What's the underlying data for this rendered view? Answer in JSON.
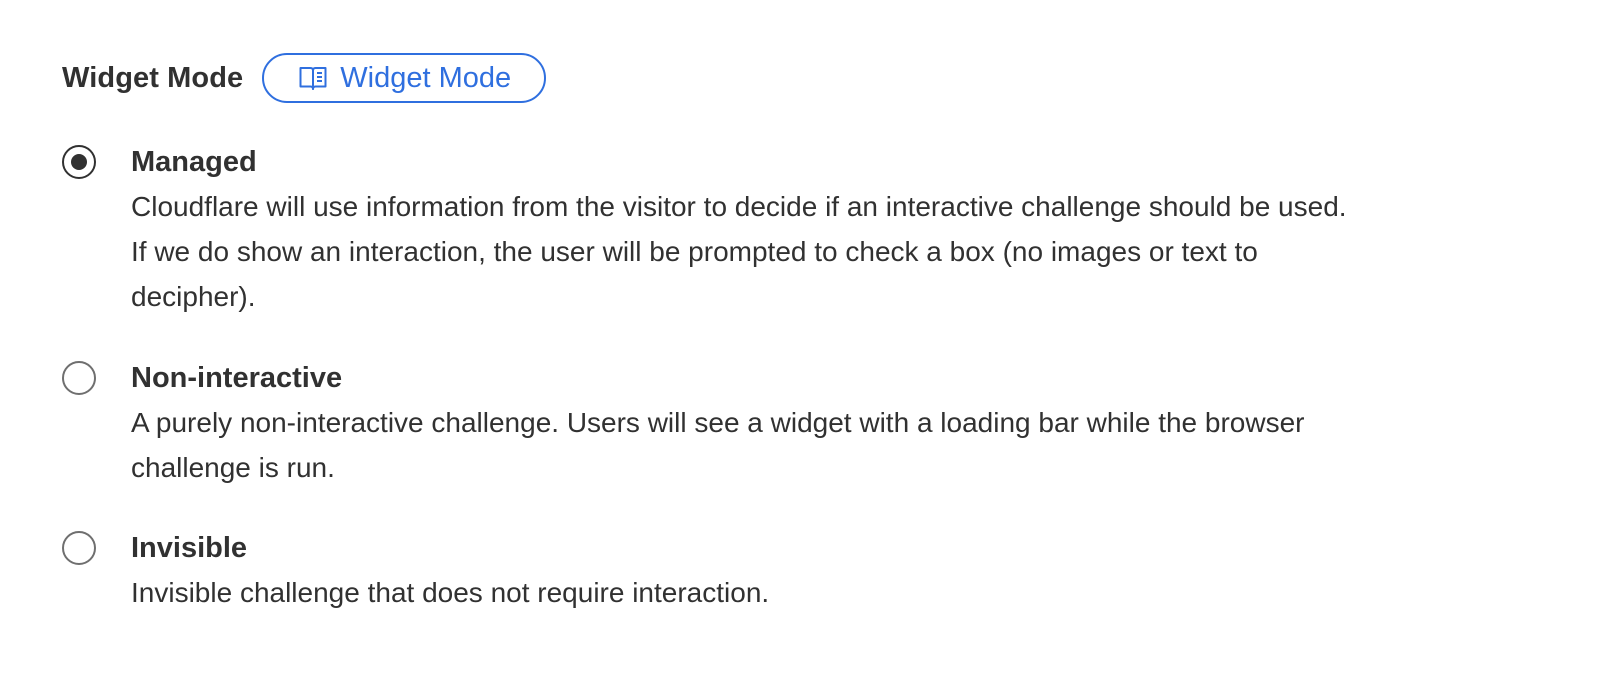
{
  "section": {
    "title": "Widget Mode",
    "doc_link_label": "Widget Mode",
    "doc_link_icon": "book-icon"
  },
  "options": [
    {
      "label": "Managed",
      "description_lines": [
        "Cloudflare will use information from the visitor to decide if an interactive challenge should be used.",
        "If we do show an interaction, the user will be prompted to check a box (no images or text to",
        "decipher)."
      ],
      "selected": true
    },
    {
      "label": "Non-interactive",
      "description_lines": [
        "A purely non-interactive challenge. Users will see a widget with a loading bar while the browser",
        "challenge is run."
      ],
      "selected": false
    },
    {
      "label": "Invisible",
      "description_lines": [
        "Invisible challenge that does not require interaction."
      ],
      "selected": false
    }
  ],
  "colors": {
    "text": "#313131",
    "link": "#2f6fdf",
    "radio_border": "#6f6f6f"
  }
}
